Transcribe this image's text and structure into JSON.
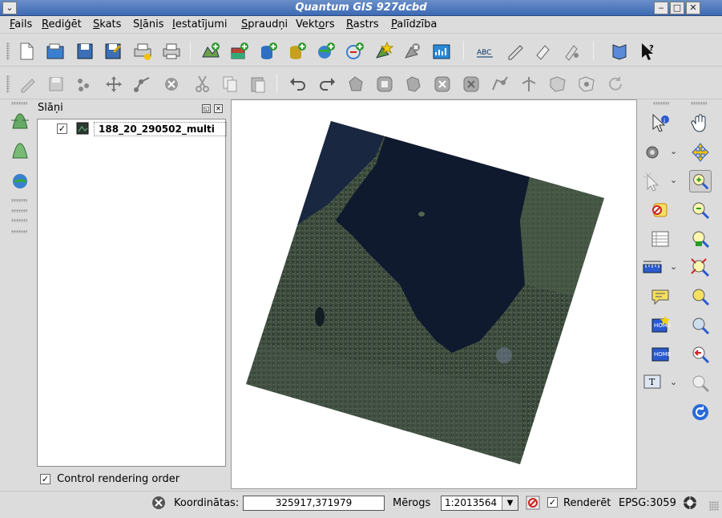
{
  "window": {
    "title": "Quantum GIS 927dcbd"
  },
  "menu": {
    "items": [
      {
        "pre": "",
        "u": "F",
        "post": "ails"
      },
      {
        "pre": "",
        "u": "R",
        "post": "ediģēt"
      },
      {
        "pre": "",
        "u": "S",
        "post": "kats"
      },
      {
        "pre": "S",
        "u": "l",
        "post": "ānis"
      },
      {
        "pre": "",
        "u": "I",
        "post": "estatījumi"
      },
      {
        "pre": "",
        "u": "S",
        "post": "praudņi"
      },
      {
        "pre": "Vekt",
        "u": "o",
        "post": "rs"
      },
      {
        "pre": "",
        "u": "R",
        "post": "astrs"
      },
      {
        "pre": "",
        "u": "P",
        "post": "alīdzība"
      }
    ]
  },
  "layers_panel": {
    "title": "Slāņi",
    "layer_name": "188_20_290502_multi",
    "layer_checked": "✓",
    "control_rendering_label": "Control rendering order",
    "control_rendering_checked": "✓"
  },
  "statusbar": {
    "coord_label": "Koordinātas:",
    "coord_value": "325917,371979",
    "scale_label": "Mērogs",
    "scale_value": "1:2013564",
    "render_label": "Renderēt",
    "render_checked": "✓",
    "crs": "EPSG:3059"
  },
  "colors": {
    "titlebar": "#3d6ab4",
    "water": "#101a2e",
    "land": "#3a4a3a"
  }
}
